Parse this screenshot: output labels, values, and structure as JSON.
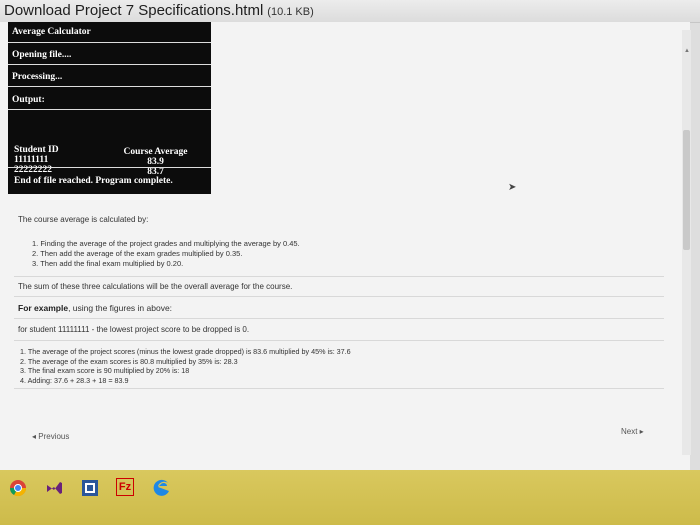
{
  "header": {
    "filename": "Download Project 7 Specifications.html",
    "filesize": "(10.1 KB)"
  },
  "console": {
    "title": "Average Calculator",
    "opening": "Opening file....",
    "processing": "Processing...",
    "output": "Output:",
    "student_header": "Student ID",
    "average_header": "Course Average",
    "rows": [
      {
        "id": "11111111",
        "avg": "83.9"
      },
      {
        "id": "22222222",
        "avg": "83.7"
      }
    ],
    "end_text": "End of file reached.  Program complete."
  },
  "description": {
    "intro": "The course average is calculated by:",
    "steps": [
      "1. Finding the average of the project grades and multiplying the average by 0.45.",
      "2. Then add the average of the exam grades multiplied by 0.35.",
      "3. Then add the final exam multiplied by 0.20."
    ],
    "sum_text": "The sum of these three calculations will be the overall average for the course.",
    "example_bold": "For example",
    "example_rest": ", using the figures in above:",
    "student_note": "for student 11111111 - the lowest project score to be dropped is 0.",
    "example_steps": [
      "1. The average of the project scores (minus the lowest grade dropped) is 83.6 multiplied by 45% is: 37.6",
      "2. The average of the exam scores is 80.8 multiplied by 35% is: 28.3",
      "3. The final exam score is 90 multiplied by 20% is: 18",
      "4. Adding: 37.6 + 28.3 + 18 = 83.9"
    ]
  },
  "nav": {
    "previous": "◂ Previous",
    "next": "Next ▸"
  },
  "taskbar": {
    "icons": [
      "chrome-icon",
      "visual-studio-icon",
      "window-app-icon",
      "filezilla-icon",
      "edge-icon"
    ],
    "filezilla_label": "Fz"
  }
}
